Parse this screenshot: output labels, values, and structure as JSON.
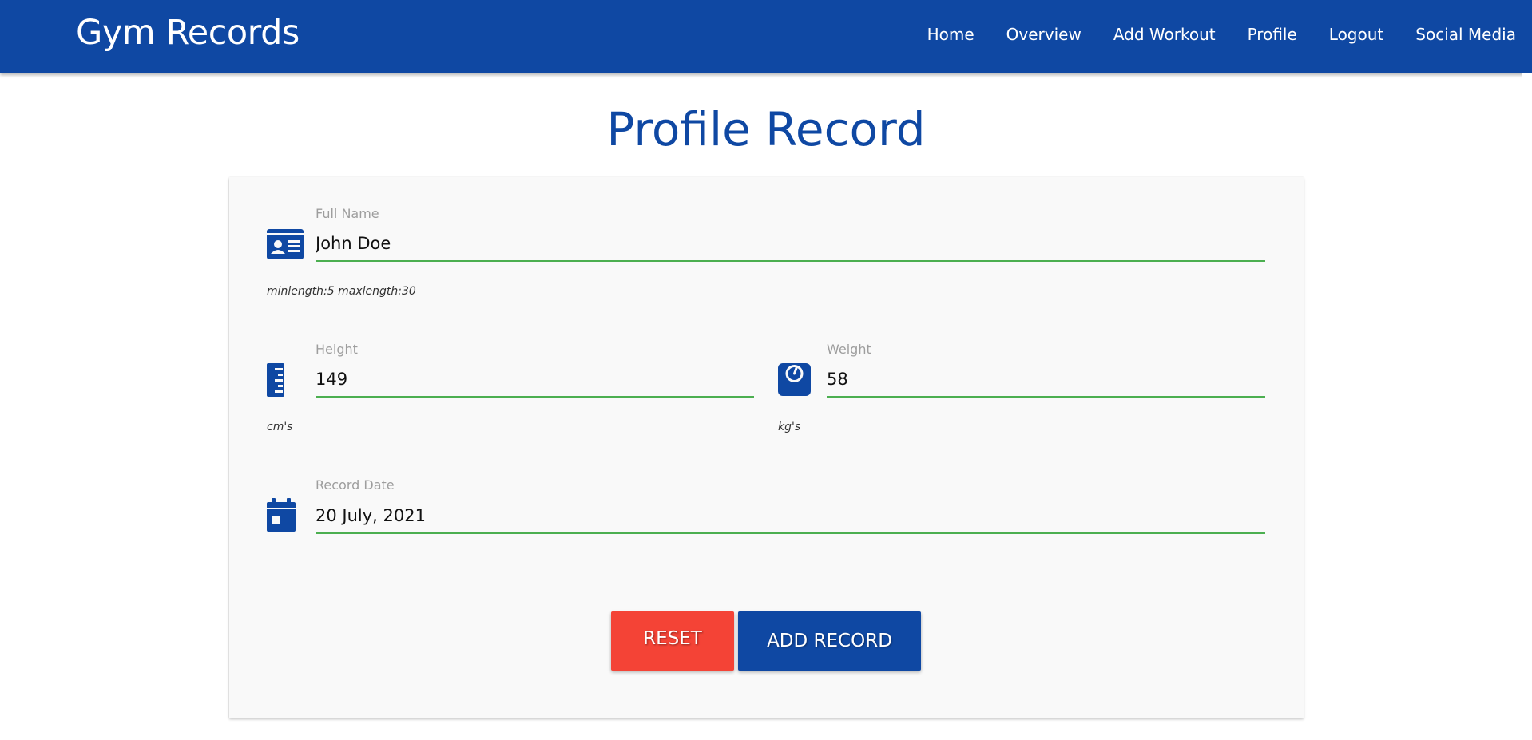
{
  "nav": {
    "brand": "Gym Records",
    "links": [
      "Home",
      "Overview",
      "Add Workout",
      "Profile",
      "Logout",
      "Social Media"
    ]
  },
  "page": {
    "title": "Profile Record"
  },
  "form": {
    "full_name": {
      "label": "Full Name",
      "value": "John Doe",
      "helper": "minlength:5 maxlength:30",
      "icon": "id-card-icon"
    },
    "height": {
      "label": "Height",
      "value": "149",
      "helper": "cm's",
      "icon": "ruler-icon"
    },
    "weight": {
      "label": "Weight",
      "value": "58",
      "helper": "kg's",
      "icon": "weight-scale-icon"
    },
    "record_date": {
      "label": "Record Date",
      "value": "20 July, 2021",
      "icon": "calendar-icon"
    }
  },
  "buttons": {
    "reset": "RESET",
    "add_record": "ADD RECORD"
  },
  "colors": {
    "primary": "#0f48a3",
    "danger": "#f44336",
    "input_underline": "#4caf50"
  }
}
